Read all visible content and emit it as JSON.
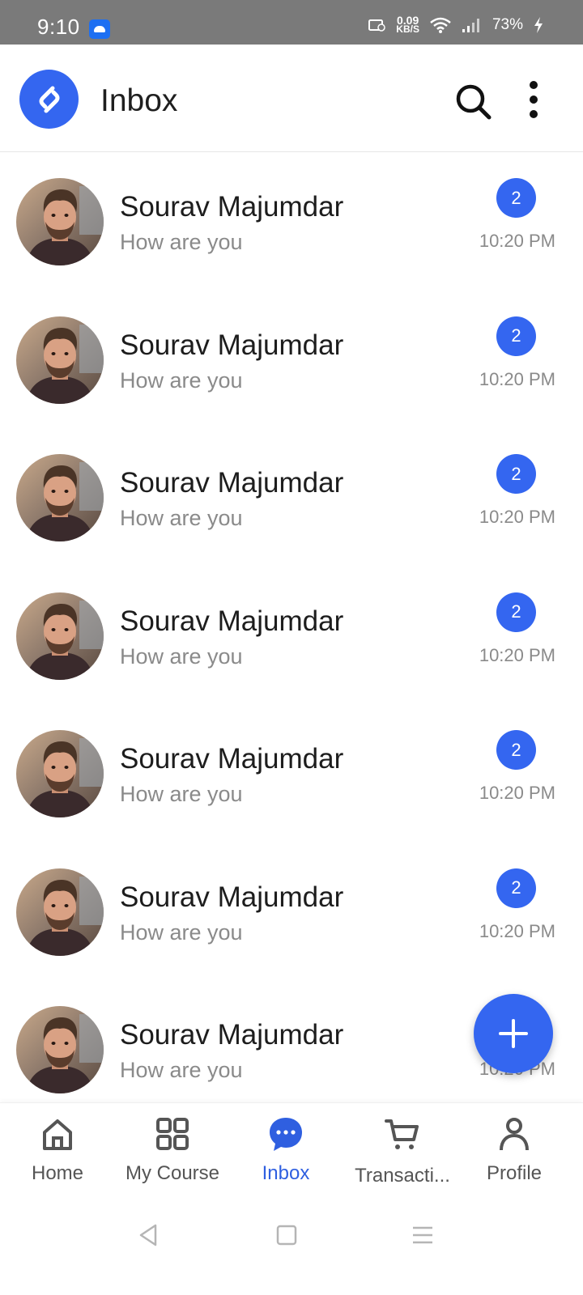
{
  "status_bar": {
    "time": "9:10",
    "speed_value": "0.09",
    "speed_unit": "KB/S",
    "battery": "73%"
  },
  "app_bar": {
    "title": "Inbox",
    "logo_icon": "logo-icon",
    "accent": "#3466f0"
  },
  "conversations": [
    {
      "name": "Sourav Majumdar",
      "preview": "How are you",
      "unread": "2",
      "time": "10:20 PM"
    },
    {
      "name": "Sourav Majumdar",
      "preview": "How are you",
      "unread": "2",
      "time": "10:20 PM"
    },
    {
      "name": "Sourav Majumdar",
      "preview": "How are you",
      "unread": "2",
      "time": "10:20 PM"
    },
    {
      "name": "Sourav Majumdar",
      "preview": "How are you",
      "unread": "2",
      "time": "10:20 PM"
    },
    {
      "name": "Sourav Majumdar",
      "preview": "How are you",
      "unread": "2",
      "time": "10:20 PM"
    },
    {
      "name": "Sourav Majumdar",
      "preview": "How are you",
      "unread": "2",
      "time": "10:20 PM"
    },
    {
      "name": "Sourav Majumdar",
      "preview": "How are you",
      "unread": "",
      "time": "10:20 PM"
    }
  ],
  "bottom_nav": {
    "items": [
      {
        "label": "Home",
        "icon": "home-icon"
      },
      {
        "label": "My Course",
        "icon": "grid-icon"
      },
      {
        "label": "Inbox",
        "icon": "chat-icon",
        "active": true
      },
      {
        "label": "Transacti...",
        "icon": "cart-icon"
      },
      {
        "label": "Profile",
        "icon": "person-icon"
      }
    ]
  }
}
